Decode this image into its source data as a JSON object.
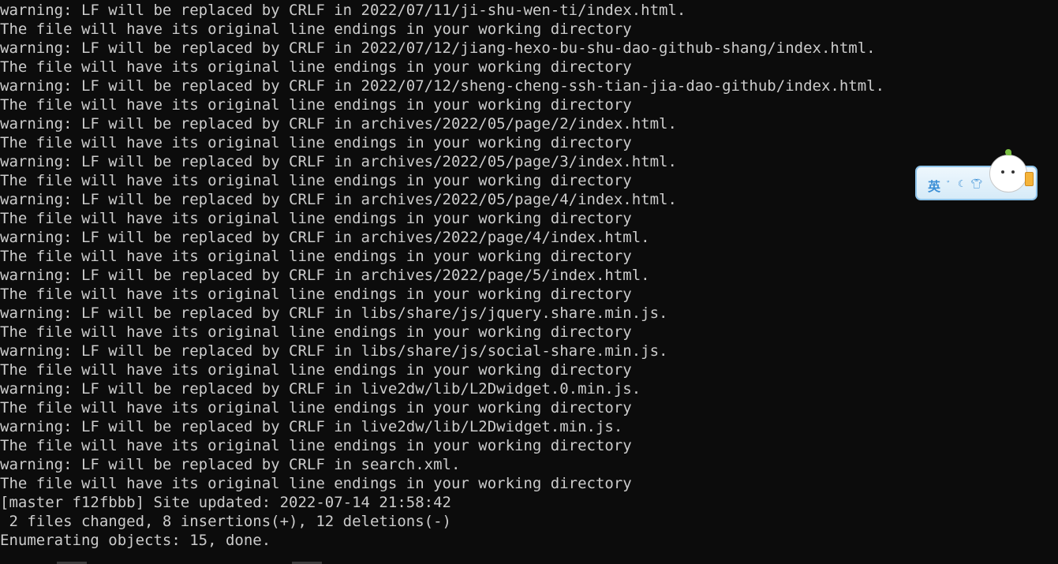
{
  "terminal": {
    "lines": [
      "warning: LF will be replaced by CRLF in 2022/07/11/ji-shu-wen-ti/index.html.",
      "The file will have its original line endings in your working directory",
      "warning: LF will be replaced by CRLF in 2022/07/12/jiang-hexo-bu-shu-dao-github-shang/index.html.",
      "The file will have its original line endings in your working directory",
      "warning: LF will be replaced by CRLF in 2022/07/12/sheng-cheng-ssh-tian-jia-dao-github/index.html.",
      "The file will have its original line endings in your working directory",
      "warning: LF will be replaced by CRLF in archives/2022/05/page/2/index.html.",
      "The file will have its original line endings in your working directory",
      "warning: LF will be replaced by CRLF in archives/2022/05/page/3/index.html.",
      "The file will have its original line endings in your working directory",
      "warning: LF will be replaced by CRLF in archives/2022/05/page/4/index.html.",
      "The file will have its original line endings in your working directory",
      "warning: LF will be replaced by CRLF in archives/2022/page/4/index.html.",
      "The file will have its original line endings in your working directory",
      "warning: LF will be replaced by CRLF in archives/2022/page/5/index.html.",
      "The file will have its original line endings in your working directory",
      "warning: LF will be replaced by CRLF in libs/share/js/jquery.share.min.js.",
      "The file will have its original line endings in your working directory",
      "warning: LF will be replaced by CRLF in libs/share/js/social-share.min.js.",
      "The file will have its original line endings in your working directory",
      "warning: LF will be replaced by CRLF in live2dw/lib/L2Dwidget.0.min.js.",
      "The file will have its original line endings in your working directory",
      "warning: LF will be replaced by CRLF in live2dw/lib/L2Dwidget.min.js.",
      "The file will have its original line endings in your working directory",
      "warning: LF will be replaced by CRLF in search.xml.",
      "The file will have its original line endings in your working directory",
      "[master f12fbbb] Site updated: 2022-07-14 21:58:42",
      " 2 files changed, 8 insertions(+), 12 deletions(-)",
      "Enumerating objects: 15, done."
    ]
  },
  "ime": {
    "language": "英",
    "icons": [
      "punctuation-icon",
      "moon-icon",
      "shirt-icon"
    ],
    "accent_color": "#3b8fd6"
  },
  "colors": {
    "background": "#0c0c0c",
    "foreground": "#cccccc"
  }
}
